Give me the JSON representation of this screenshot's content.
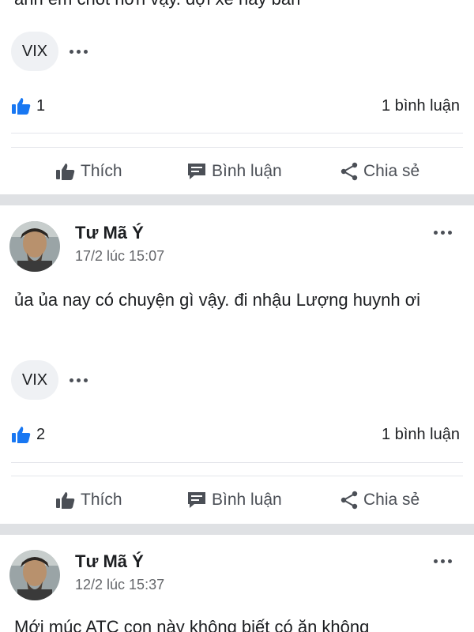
{
  "top": {
    "cut_text": "anh em chốt hơn vậy. đợi xe này bán",
    "reaction_chip": "VIX",
    "like_count": "1",
    "comment_count": "1 bình luận"
  },
  "actions": {
    "like": "Thích",
    "comment": "Bình luận",
    "share": "Chia sẻ"
  },
  "posts": [
    {
      "author": "Tư Mã Ý",
      "date": "17/2 lúc 15:07",
      "body": "ủa ủa nay có chuyện gì vậy. đi nhậu Lượng huynh ơi",
      "reaction_chip": "VIX",
      "like_count": "2",
      "comment_count": "1 bình luận"
    },
    {
      "author": "Tư Mã Ý",
      "date": "12/2 lúc 15:37",
      "body": "Mới múc ATC con này không biết có ăn không"
    }
  ],
  "colors": {
    "like_blue": "#1877f2",
    "separator": "#dfe1e4",
    "muted": "#65676b"
  }
}
